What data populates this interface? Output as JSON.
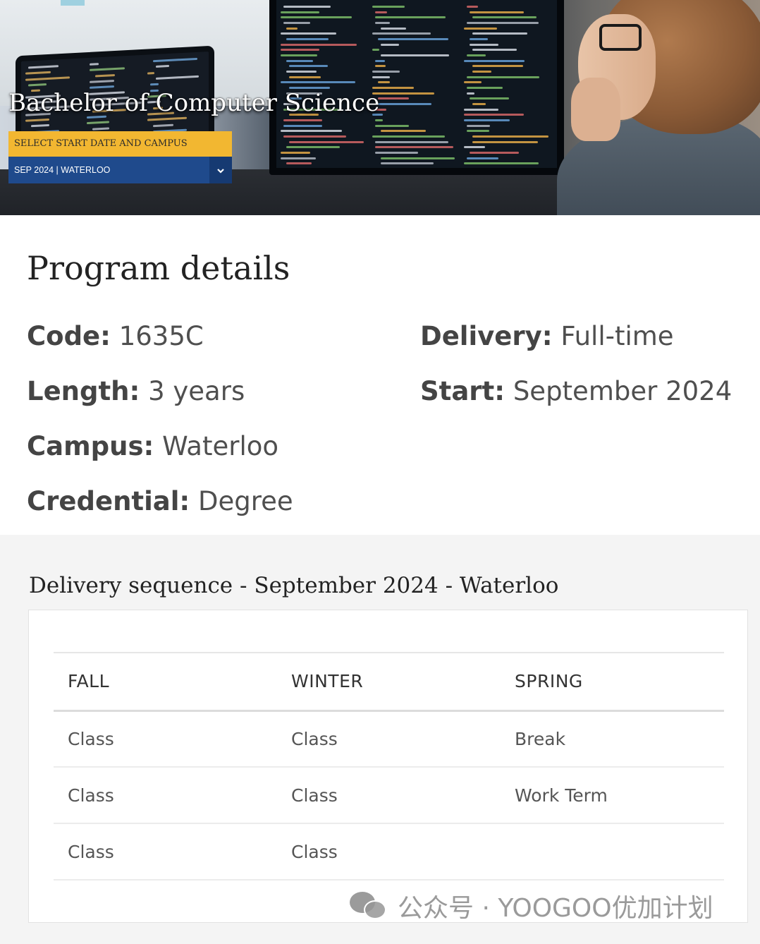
{
  "hero": {
    "title": "Bachelor of Computer Science",
    "select_label": "SELECT START DATE AND CAMPUS",
    "selected_value": "SEP 2024 | WATERLOO"
  },
  "details": {
    "heading": "Program details",
    "fields": [
      {
        "key": "Code:",
        "value": "1635C"
      },
      {
        "key": "Delivery:",
        "value": "Full-time"
      },
      {
        "key": "Length:",
        "value": "3 years"
      },
      {
        "key": "Start:",
        "value": "September 2024"
      },
      {
        "key": "Campus:",
        "value": "Waterloo"
      },
      {
        "key": "Credential:",
        "value": "Degree"
      }
    ]
  },
  "delivery": {
    "heading": "Delivery sequence - September 2024 - Waterloo",
    "columns": [
      "FALL",
      "WINTER",
      "SPRING"
    ],
    "rows": [
      [
        "Class",
        "Class",
        "Break"
      ],
      [
        "Class",
        "Class",
        "Work Term"
      ],
      [
        "Class",
        "Class",
        ""
      ]
    ]
  },
  "watermark": {
    "text": "公众号 · YOOGOO优加计划"
  },
  "colors": {
    "select_label_bg": "#f2b731",
    "select_box_bg": "#1f4a8c",
    "delivery_bg": "#f4f4f4"
  },
  "icons": {
    "dropdown": "chevron-down-icon",
    "watermark": "wechat-icon"
  }
}
